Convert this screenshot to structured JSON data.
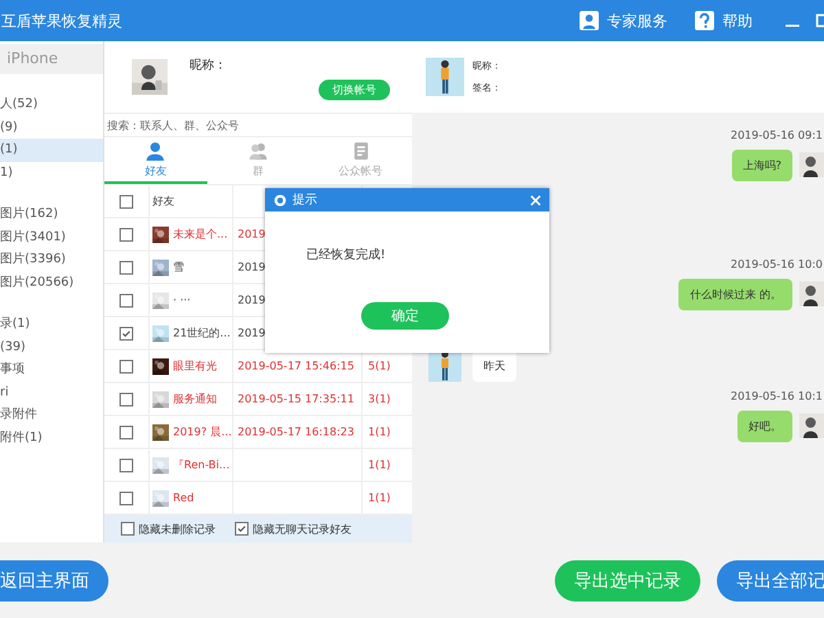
{
  "window": {
    "title": "互盾苹果恢复精灵",
    "actions": [
      {
        "kind": "expert",
        "label": "专家服务"
      },
      {
        "kind": "help",
        "label": "帮助"
      }
    ]
  },
  "sidebar": {
    "header": "iPhone",
    "groups": [
      {
        "items": [
          {
            "label": "人(52)",
            "selected": false
          },
          {
            "label": "(9)",
            "selected": false
          },
          {
            "label": "(1)",
            "selected": true
          },
          {
            "label": "1)",
            "selected": false
          }
        ]
      },
      {
        "items": [
          {
            "label": "图片(162)",
            "selected": false
          },
          {
            "label": "图片(3401)",
            "selected": false
          },
          {
            "label": "图片(3396)",
            "selected": false
          },
          {
            "label": "图片(20566)",
            "selected": false
          }
        ]
      },
      {
        "items": [
          {
            "label": "录(1)",
            "selected": false
          },
          {
            "label": "(39)",
            "selected": false
          },
          {
            "label": "事项",
            "selected": false
          },
          {
            "label": "ri",
            "selected": false
          },
          {
            "label": "录附件",
            "selected": false
          },
          {
            "label": "附件(1)",
            "selected": false
          }
        ]
      }
    ]
  },
  "account": {
    "nickname_label": "昵称：",
    "switch_button": "切换帐号"
  },
  "search": {
    "placeholder": "搜索：联系人、群、公众号"
  },
  "tabs": [
    {
      "kind": "person",
      "label": "好友",
      "selected": true
    },
    {
      "kind": "group",
      "label": "群",
      "selected": false
    },
    {
      "kind": "official",
      "label": "公众帐号",
      "selected": false
    }
  ],
  "table": {
    "select_all": false,
    "columns": [
      {
        "label": "好友"
      }
    ],
    "rows": [
      {
        "checked": false,
        "deleted": true,
        "name": "未来是个...",
        "time": "2019"
      },
      {
        "checked": false,
        "deleted": false,
        "name": "雪",
        "time": "2019"
      },
      {
        "checked": false,
        "deleted": false,
        "name": "· ···",
        "time": "2019"
      },
      {
        "checked": true,
        "deleted": false,
        "name": "21世纪的...",
        "time": "2019"
      },
      {
        "checked": false,
        "deleted": true,
        "name": "眼里有光",
        "time": "2019-05-17 15:46:15",
        "count": "5(1)"
      },
      {
        "checked": false,
        "deleted": true,
        "name": "服务通知",
        "time": "2019-05-15 17:35:11",
        "count": "3(1)"
      },
      {
        "checked": false,
        "deleted": true,
        "name": "2019? 晨...",
        "time": "2019-05-17 16:18:23",
        "count": "1(1)"
      },
      {
        "checked": false,
        "deleted": true,
        "name": "『Ren-Bi...",
        "count": "1(1)"
      },
      {
        "checked": false,
        "deleted": true,
        "name": "Red",
        "count": "1(1)"
      }
    ]
  },
  "filters": [
    {
      "label": "隐藏未删除记录",
      "checked": false
    },
    {
      "label": "隐藏无聊天记录好友",
      "checked": true
    }
  ],
  "chat": {
    "nickname_label": "昵称：",
    "signature_label": "签名：",
    "messages": [
      {
        "kind": "time",
        "text": "2019-05-16 09:1"
      },
      {
        "kind": "sent",
        "text": "上海吗?"
      },
      {
        "kind": "time",
        "text": "2019-05-16 10:0"
      },
      {
        "kind": "sent",
        "text": "什么时候过来 的。"
      },
      {
        "kind": "received",
        "text": "昨天"
      },
      {
        "kind": "time",
        "text": "2019-05-16 10:1"
      },
      {
        "kind": "sent",
        "text": "好吧。"
      }
    ]
  },
  "dialog": {
    "title": "提示",
    "message": "已经恢复完成!",
    "button": "确定"
  },
  "buttons": [
    {
      "kind": "back",
      "label": "返回主界面"
    },
    {
      "kind": "export_selected",
      "label": "导出选中记录"
    },
    {
      "kind": "export_all",
      "label": "导出全部记"
    }
  ]
}
